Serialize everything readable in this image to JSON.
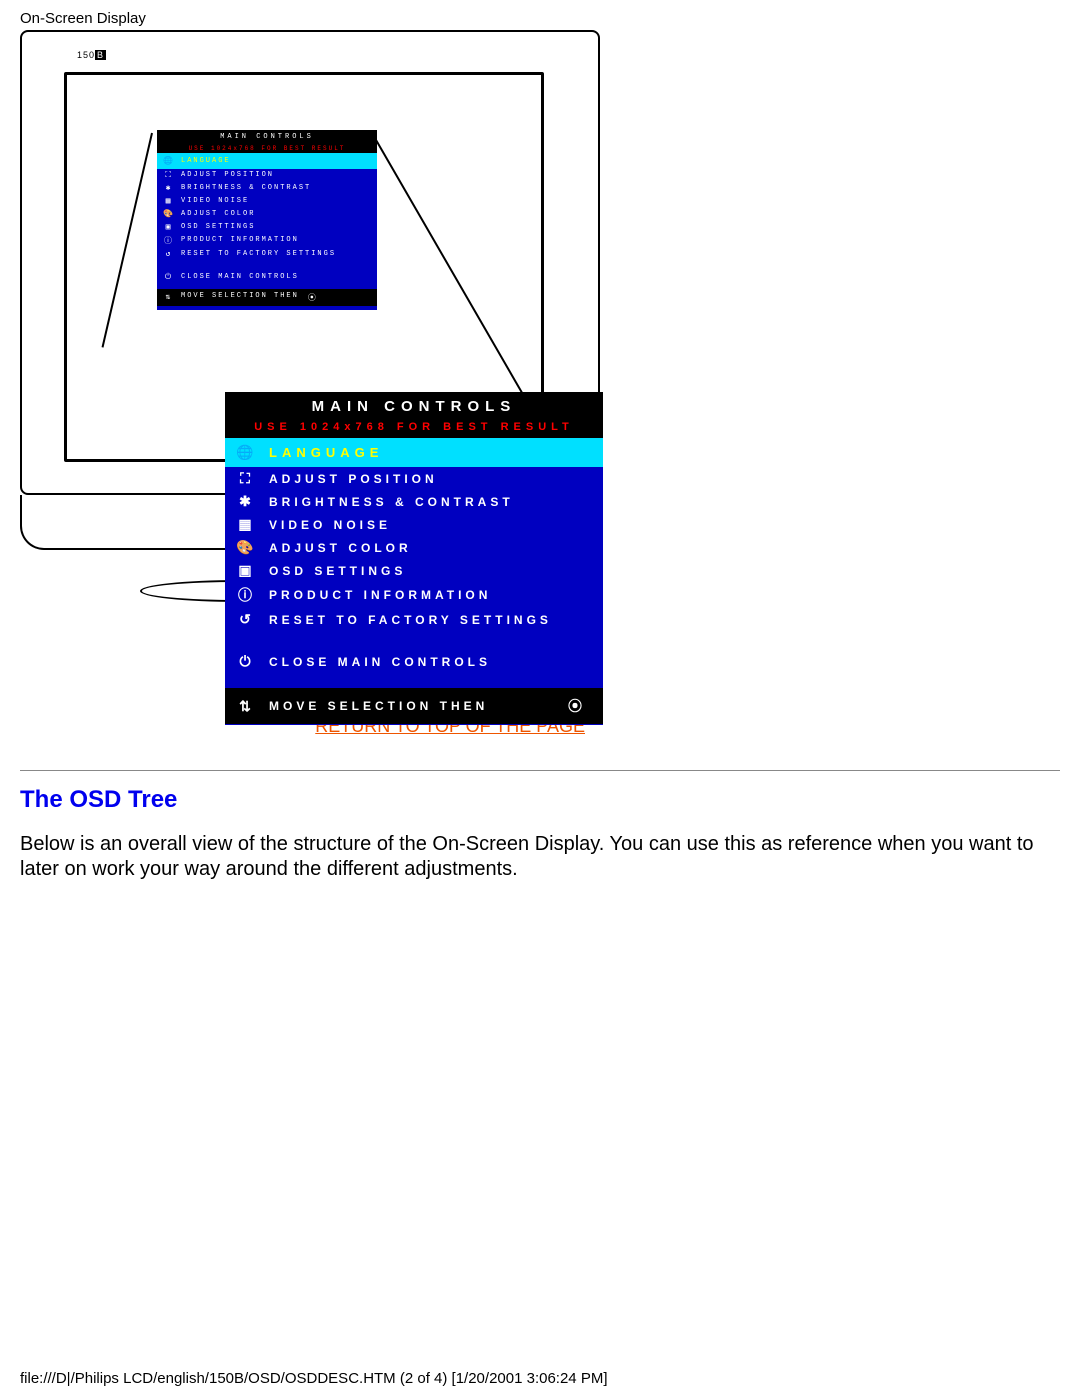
{
  "header": "On-Screen Display",
  "monitor_model_prefix": "150",
  "monitor_model_suffix": "B",
  "osd_panel": {
    "title": "MAIN CONTROLS",
    "hint": "USE 1024x768 FOR BEST RESULT",
    "selected": {
      "icon": "globe-icon",
      "label": "LANGUAGE"
    },
    "items": [
      {
        "icon": "frame-icon",
        "label": "ADJUST POSITION"
      },
      {
        "icon": "sun-icon",
        "label": "BRIGHTNESS & CONTRAST"
      },
      {
        "icon": "grid-icon",
        "label": "VIDEO NOISE"
      },
      {
        "icon": "palette-icon",
        "label": "ADJUST COLOR"
      },
      {
        "icon": "window-icon",
        "label": "OSD SETTINGS"
      },
      {
        "icon": "info-icon",
        "label": "PRODUCT INFORMATION"
      },
      {
        "icon": "reset-icon",
        "label": "RESET TO FACTORY SETTINGS"
      }
    ],
    "close": {
      "icon": "power-icon",
      "label": "CLOSE MAIN CONTROLS"
    },
    "footer": {
      "icon": "updown-icon",
      "label": "MOVE SELECTION THEN",
      "trail_icon": "ok-icon"
    }
  },
  "return_link": "RETURN TO TOP OF THE PAGE",
  "section_heading": "The OSD Tree",
  "section_body": "Below is an overall view of the structure of the On-Screen Display. You can use this as reference when you want to later on work your way around the different adjustments.",
  "footer": "file:///D|/Philips LCD/english/150B/OSD/OSDDESC.HTM (2 of 4) [1/20/2001 3:06:24 PM]",
  "icon_glyphs": {
    "globe-icon": "🌐",
    "frame-icon": "⛶",
    "sun-icon": "✱",
    "grid-icon": "▦",
    "palette-icon": "🎨",
    "window-icon": "▣",
    "info-icon": "ⓘ",
    "reset-icon": "↺",
    "power-icon": "⏻",
    "updown-icon": "⇅",
    "ok-icon": "⦿"
  }
}
